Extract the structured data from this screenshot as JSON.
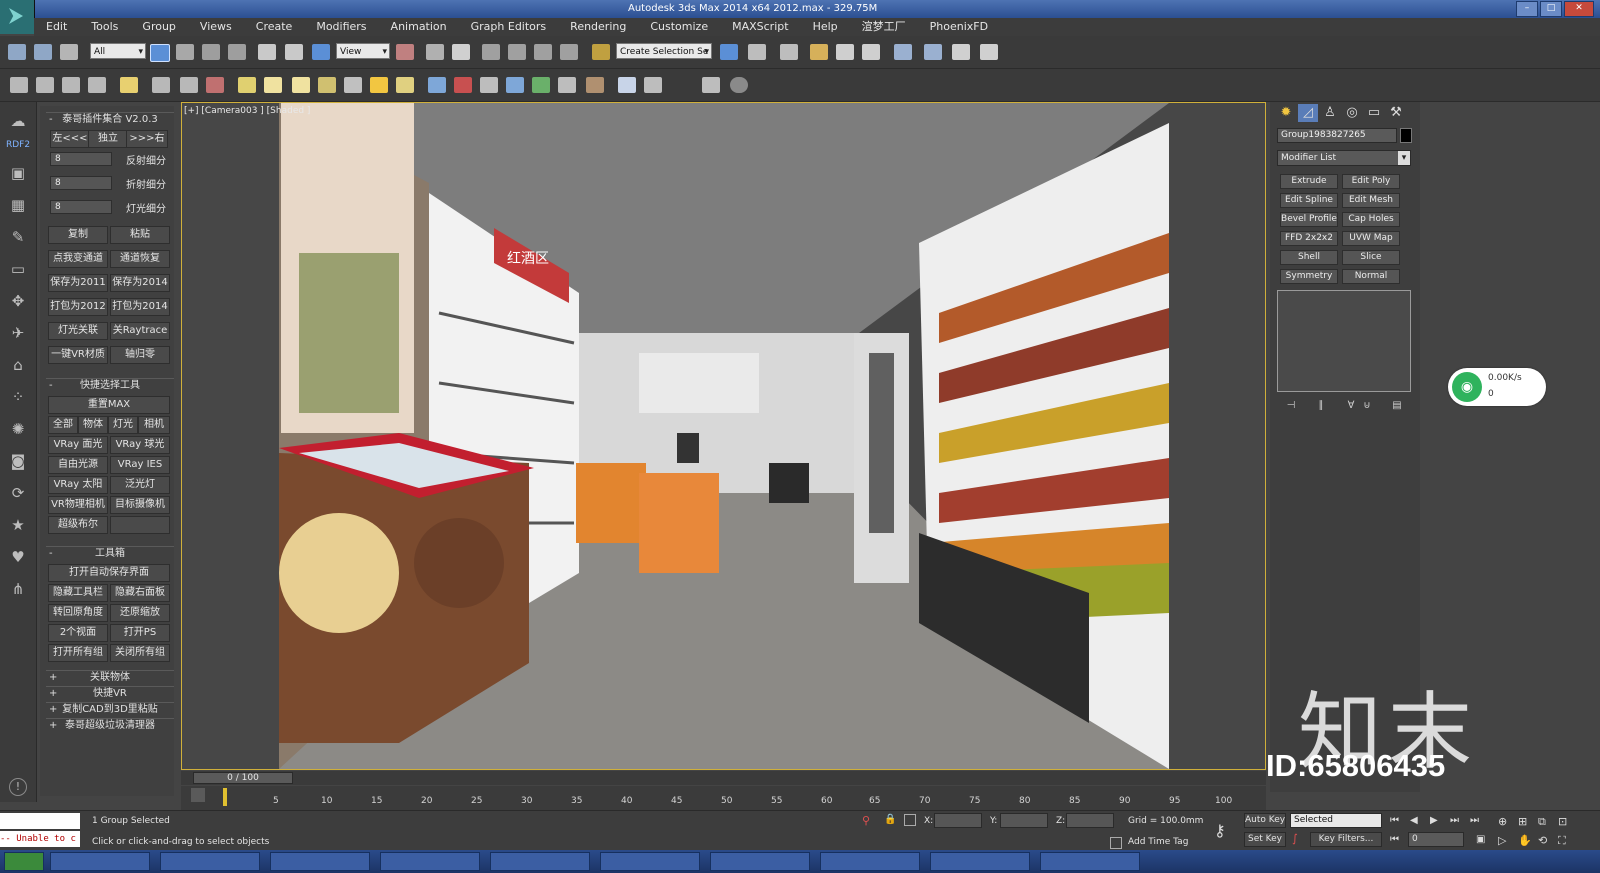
{
  "window": {
    "title": "Autodesk 3ds Max  2014 x64      2012.max - 329.75M"
  },
  "menu": [
    "Edit",
    "Tools",
    "Group",
    "Views",
    "Create",
    "Modifiers",
    "Animation",
    "Graph Editors",
    "Rendering",
    "Customize",
    "MAXScript",
    "Help",
    "渲梦工厂",
    "PhoenixFD"
  ],
  "toolbar": {
    "selection_filter": "All",
    "reference_coord": "View",
    "named_selection": "Create Selection Se"
  },
  "left_column": {
    "top_label": "RDF2"
  },
  "plugin": {
    "title": "泰哥插件集合 V2.0.3",
    "left_btn": "左<<<",
    "solo_btn": "独立",
    "right_btn": ">>>右",
    "spinners": [
      {
        "value": "8",
        "label": "反射细分"
      },
      {
        "value": "8",
        "label": "折射细分"
      },
      {
        "value": "8",
        "label": "灯光细分"
      }
    ],
    "buttons_row1": [
      "复制",
      "粘贴"
    ],
    "buttons_row2": [
      "点我变通道",
      "通道恢复"
    ],
    "buttons_row3": [
      "保存为2011",
      "保存为2014"
    ],
    "buttons_row4": [
      "打包为2012",
      "打包为2014"
    ],
    "buttons_row5": [
      "灯光关联",
      "关Raytrace"
    ],
    "buttons_row6": [
      "一键VR材质",
      "轴归零"
    ],
    "quick_select_title": "快捷选择工具",
    "reset_max": "重置MAX",
    "quick_row1": [
      "全部",
      "物体",
      "灯光",
      "相机"
    ],
    "quick_row2": [
      "VRay 面光",
      "VRay 球光"
    ],
    "quick_row3": [
      "自由光源",
      "VRay IES"
    ],
    "quick_row4": [
      "VRay 太阳",
      "泛光灯"
    ],
    "quick_row5": [
      "VR物理相机",
      "目标摄像机"
    ],
    "quick_row6": [
      "超级布尔",
      ""
    ],
    "toolbox_title": "工具箱",
    "autosave": "打开自动保存界面",
    "tool_row1": [
      "隐藏工具栏",
      "隐藏右面板"
    ],
    "tool_row2": [
      "转回原角度",
      "还原缩放"
    ],
    "tool_row3": [
      "2个视面",
      "打开PS"
    ],
    "tool_row4": [
      "打开所有组",
      "关闭所有组"
    ],
    "collapsed": [
      "关联物体",
      "快捷VR",
      "复制CAD到3D里粘贴",
      "泰哥超级垃圾清理器"
    ]
  },
  "viewport": {
    "label": "[+] [Camera003 ] [Shaded ]",
    "signs": [
      "红酒区"
    ]
  },
  "command_panel": {
    "object_name": "Group1983827265",
    "modifier_list": "Modifier List",
    "modifiers": [
      [
        "Extrude",
        "Edit Poly"
      ],
      [
        "Edit Spline",
        "Edit Mesh"
      ],
      [
        "Bevel Profile",
        "Cap Holes"
      ],
      [
        "FFD 2x2x2",
        "UVW Map"
      ],
      [
        "Shell",
        "Slice"
      ],
      [
        "Symmetry",
        "Normal"
      ]
    ]
  },
  "network": {
    "speed": "0.00K/s",
    "count": "0"
  },
  "watermark": {
    "brand": "知末",
    "id": "ID:65806435"
  },
  "timeline": {
    "position": "0 / 100",
    "frames": [
      "5",
      "10",
      "15",
      "20",
      "25",
      "30",
      "35",
      "40",
      "45",
      "50",
      "55",
      "60",
      "65",
      "70",
      "75",
      "80",
      "85",
      "90",
      "95",
      "100"
    ]
  },
  "status": {
    "selection": "1 Group Selected",
    "prompt": "Click or click-and-drag to select objects",
    "error": "-- Unable to c",
    "x_label": "X:",
    "y_label": "Y:",
    "z_label": "Z:",
    "grid": "Grid = 100.0mm",
    "add_time_tag": "Add Time Tag",
    "auto_key": "Auto Key",
    "set_key": "Set Key",
    "key_mode": "Selected",
    "key_filters": "Key Filters...",
    "frame": "0"
  }
}
